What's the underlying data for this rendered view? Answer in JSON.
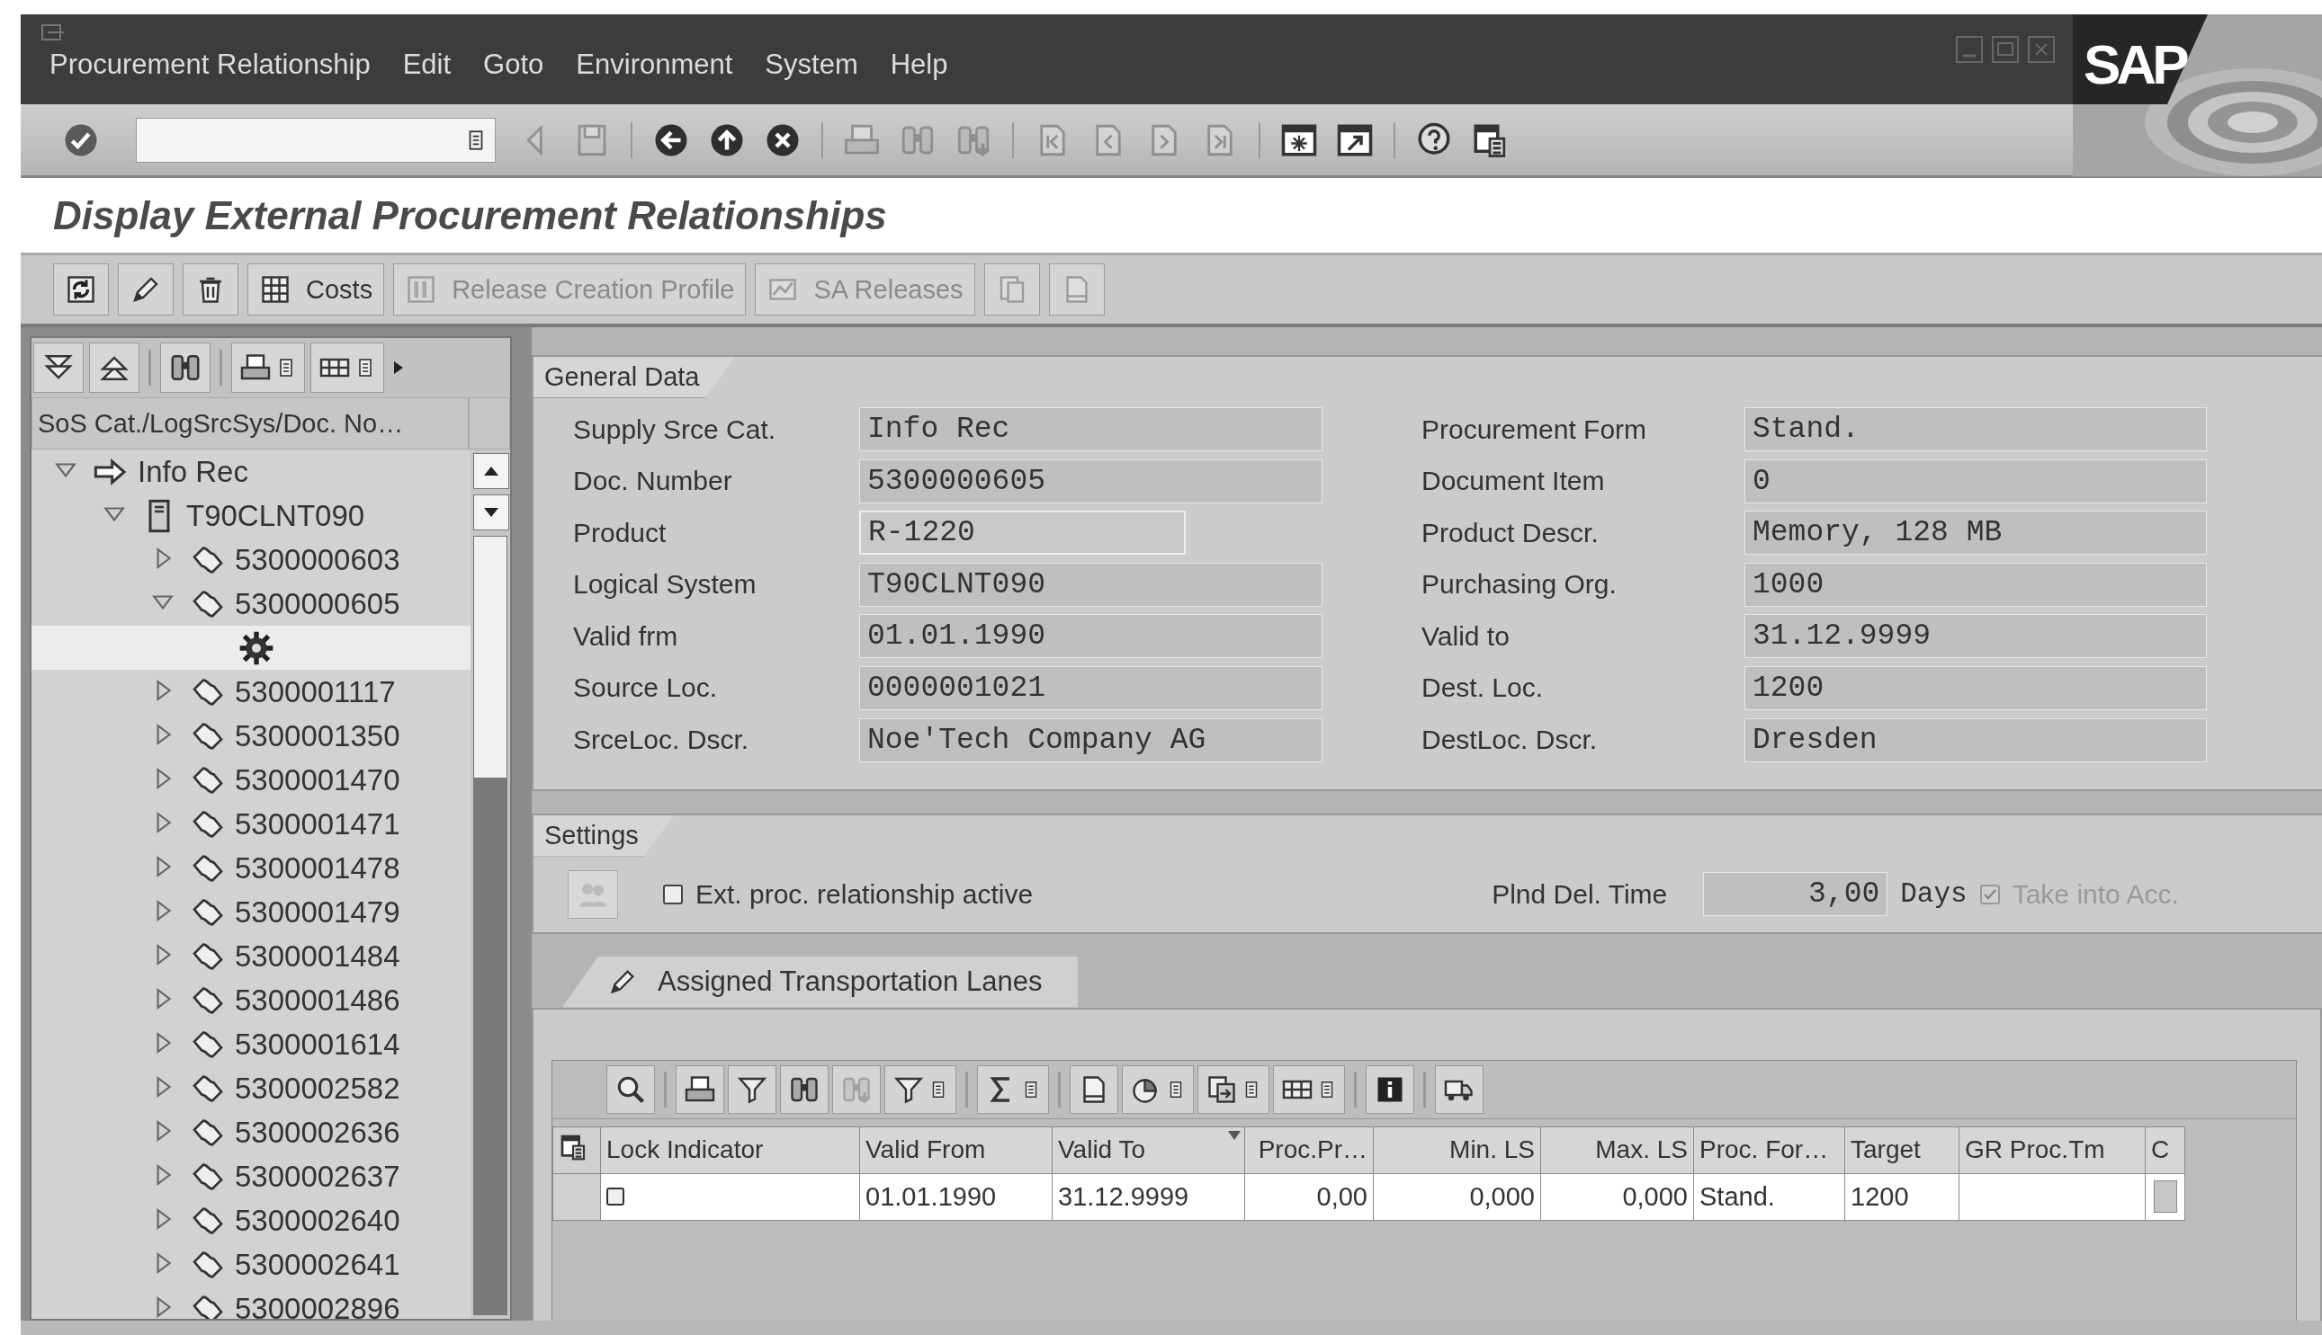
{
  "menu_bar": [
    "Procurement Relationship",
    "Edit",
    "Goto",
    "Environment",
    "System",
    "Help"
  ],
  "logo": "SAP",
  "standard_toolbar": [
    [
      {
        "kind": "enter",
        "disabled": false
      }
    ],
    [
      {
        "kind": "left",
        "disabled": true
      },
      {
        "kind": "save",
        "disabled": true
      }
    ],
    [
      {
        "kind": "back",
        "disabled": false
      },
      {
        "kind": "exit",
        "disabled": false
      },
      {
        "kind": "cancel",
        "disabled": false
      }
    ],
    [
      {
        "kind": "print",
        "disabled": true
      },
      {
        "kind": "find",
        "disabled": true
      },
      {
        "kind": "findnext",
        "disabled": true
      }
    ],
    [
      {
        "kind": "first",
        "disabled": true
      },
      {
        "kind": "prev",
        "disabled": true
      },
      {
        "kind": "next",
        "disabled": true
      },
      {
        "kind": "last",
        "disabled": true
      }
    ],
    [
      {
        "kind": "session",
        "disabled": false
      },
      {
        "kind": "shortcut",
        "disabled": false
      }
    ],
    [
      {
        "kind": "help",
        "disabled": false
      },
      {
        "kind": "layout",
        "disabled": false
      }
    ]
  ],
  "title": "Display External Procurement Relationships",
  "application_toolbar": [
    {
      "kind": "refresh",
      "disabled": false
    },
    {
      "kind": "change",
      "disabled": false
    },
    {
      "kind": "delete",
      "disabled": false
    },
    {
      "kind": "costs",
      "label": "Costs",
      "disabled": false
    },
    {
      "kind": "release",
      "label": "Release Creation Profile",
      "disabled": true
    },
    {
      "kind": "sa",
      "label": "SA Releases",
      "disabled": true
    },
    {
      "kind": "doc",
      "disabled": true
    },
    {
      "kind": "page",
      "disabled": true
    }
  ],
  "tree": {
    "column_header": "SoS Cat./LogSrcSys/Doc. No…",
    "nodes": [
      {
        "kind": "arrow",
        "label": "Info Rec",
        "expanded": true,
        "selected": false,
        "children": [
          {
            "kind": "system",
            "label": "T90CLNT090",
            "expanded": true,
            "selected": false,
            "children": [
              {
                "kind": "document",
                "label": "5300000603",
                "expanded": false,
                "selected": false
              },
              {
                "kind": "document",
                "label": "5300000605",
                "expanded": true,
                "selected": false,
                "children": [
                  {
                    "kind": "gear",
                    "selected": true
                  }
                ]
              },
              {
                "kind": "document",
                "label": "5300001117",
                "expanded": false,
                "selected": false
              },
              {
                "kind": "document",
                "label": "5300001350",
                "expanded": false,
                "selected": false
              },
              {
                "kind": "document",
                "label": "5300001470",
                "expanded": false,
                "selected": false
              },
              {
                "kind": "document",
                "label": "5300001471",
                "expanded": false,
                "selected": false
              },
              {
                "kind": "document",
                "label": "5300001478",
                "expanded": false,
                "selected": false
              },
              {
                "kind": "document",
                "label": "5300001479",
                "expanded": false,
                "selected": false
              },
              {
                "kind": "document",
                "label": "5300001484",
                "expanded": false,
                "selected": false
              },
              {
                "kind": "document",
                "label": "5300001486",
                "expanded": false,
                "selected": false
              },
              {
                "kind": "document",
                "label": "5300001614",
                "expanded": false,
                "selected": false
              },
              {
                "kind": "document",
                "label": "5300002582",
                "expanded": false,
                "selected": false
              },
              {
                "kind": "document",
                "label": "5300002636",
                "expanded": false,
                "selected": false
              },
              {
                "kind": "document",
                "label": "5300002637",
                "expanded": false,
                "selected": false
              },
              {
                "kind": "document",
                "label": "5300002640",
                "expanded": false,
                "selected": false
              },
              {
                "kind": "document",
                "label": "5300002641",
                "expanded": false,
                "selected": false
              },
              {
                "kind": "document",
                "label": "5300002896",
                "expanded": false,
                "selected": false
              }
            ]
          }
        ]
      }
    ]
  },
  "general_data": {
    "title": "General Data",
    "left": [
      {
        "label": "Supply Srce Cat.",
        "value": "Info Rec",
        "kind": "display"
      },
      {
        "label": "Doc. Number",
        "value": "5300000605",
        "kind": "display"
      },
      {
        "label": "Product",
        "value": "R-1220",
        "kind": "input"
      },
      {
        "label": "Logical System",
        "value": "T90CLNT090",
        "kind": "display"
      },
      {
        "label": "Valid frm",
        "value": "01.01.1990",
        "kind": "display"
      },
      {
        "label": "Source Loc.",
        "value": "0000001021",
        "kind": "display"
      },
      {
        "label": "SrceLoc. Dscr.",
        "value": "Noe'Tech Company AG",
        "kind": "display"
      }
    ],
    "right": [
      {
        "label": "Procurement Form",
        "value": "Stand.",
        "kind": "display"
      },
      {
        "label": "Document Item",
        "value": "0",
        "kind": "display"
      },
      {
        "label": "Product Descr.",
        "value": "Memory, 128 MB",
        "kind": "display"
      },
      {
        "label": "Purchasing Org.",
        "value": "1000",
        "kind": "display"
      },
      {
        "label": "Valid to",
        "value": "31.12.9999",
        "kind": "display"
      },
      {
        "label": "Dest. Loc.",
        "value": "1200",
        "kind": "display"
      },
      {
        "label": "DestLoc. Dscr.",
        "value": "Dresden",
        "kind": "display"
      }
    ]
  },
  "settings": {
    "title": "Settings",
    "active": {
      "label": "Ext. proc. relationship active",
      "checked": false
    },
    "delivery_time": {
      "label": "Plnd Del. Time",
      "value": "3,00",
      "unit": "Days"
    },
    "take_into_account": {
      "label": "Take into Acc.",
      "checked": true,
      "disabled": true
    }
  },
  "tabs": [
    {
      "label": "Assigned Transportation Lanes",
      "selected": true
    }
  ],
  "table": {
    "toolbar": [
      [
        {
          "kind": "details",
          "menu": false,
          "disabled": false
        }
      ],
      [
        {
          "kind": "print",
          "menu": false,
          "disabled": false
        },
        {
          "kind": "filter",
          "menu": false,
          "disabled": false
        },
        {
          "kind": "find",
          "menu": false,
          "disabled": false
        },
        {
          "kind": "findnext",
          "menu": false,
          "disabled": true
        },
        {
          "kind": "filter",
          "menu": true,
          "disabled": false
        }
      ],
      [
        {
          "kind": "sum",
          "menu": true,
          "disabled": false
        }
      ],
      [
        {
          "kind": "page",
          "menu": false,
          "disabled": false
        },
        {
          "kind": "chart",
          "menu": true,
          "disabled": false
        },
        {
          "kind": "export",
          "menu": true,
          "disabled": false
        },
        {
          "kind": "grid",
          "menu": true,
          "disabled": false
        }
      ],
      [
        {
          "kind": "info",
          "menu": false,
          "disabled": false
        }
      ],
      [
        {
          "kind": "truck",
          "menu": false,
          "disabled": false
        }
      ]
    ],
    "columns": [
      {
        "label": "Lock Indicator",
        "sorted": false
      },
      {
        "label": "Valid From",
        "sorted": false
      },
      {
        "label": "Valid To",
        "sorted": true
      },
      {
        "label": "Proc.Pr…",
        "sorted": false
      },
      {
        "label": "Min. LS",
        "sorted": false
      },
      {
        "label": "Max. LS",
        "sorted": false
      },
      {
        "label": "Proc. For…",
        "sorted": false
      },
      {
        "label": "Target",
        "sorted": false
      },
      {
        "label": "GR Proc.Tm",
        "sorted": false
      },
      {
        "label": "C",
        "sorted": false
      }
    ],
    "rows": [
      {
        "locked": false,
        "cells": [
          "",
          "01.01.1990",
          "31.12.9999",
          "0,00",
          "0,000",
          "0,000",
          "Stand.",
          "1200",
          "",
          ""
        ]
      }
    ]
  }
}
